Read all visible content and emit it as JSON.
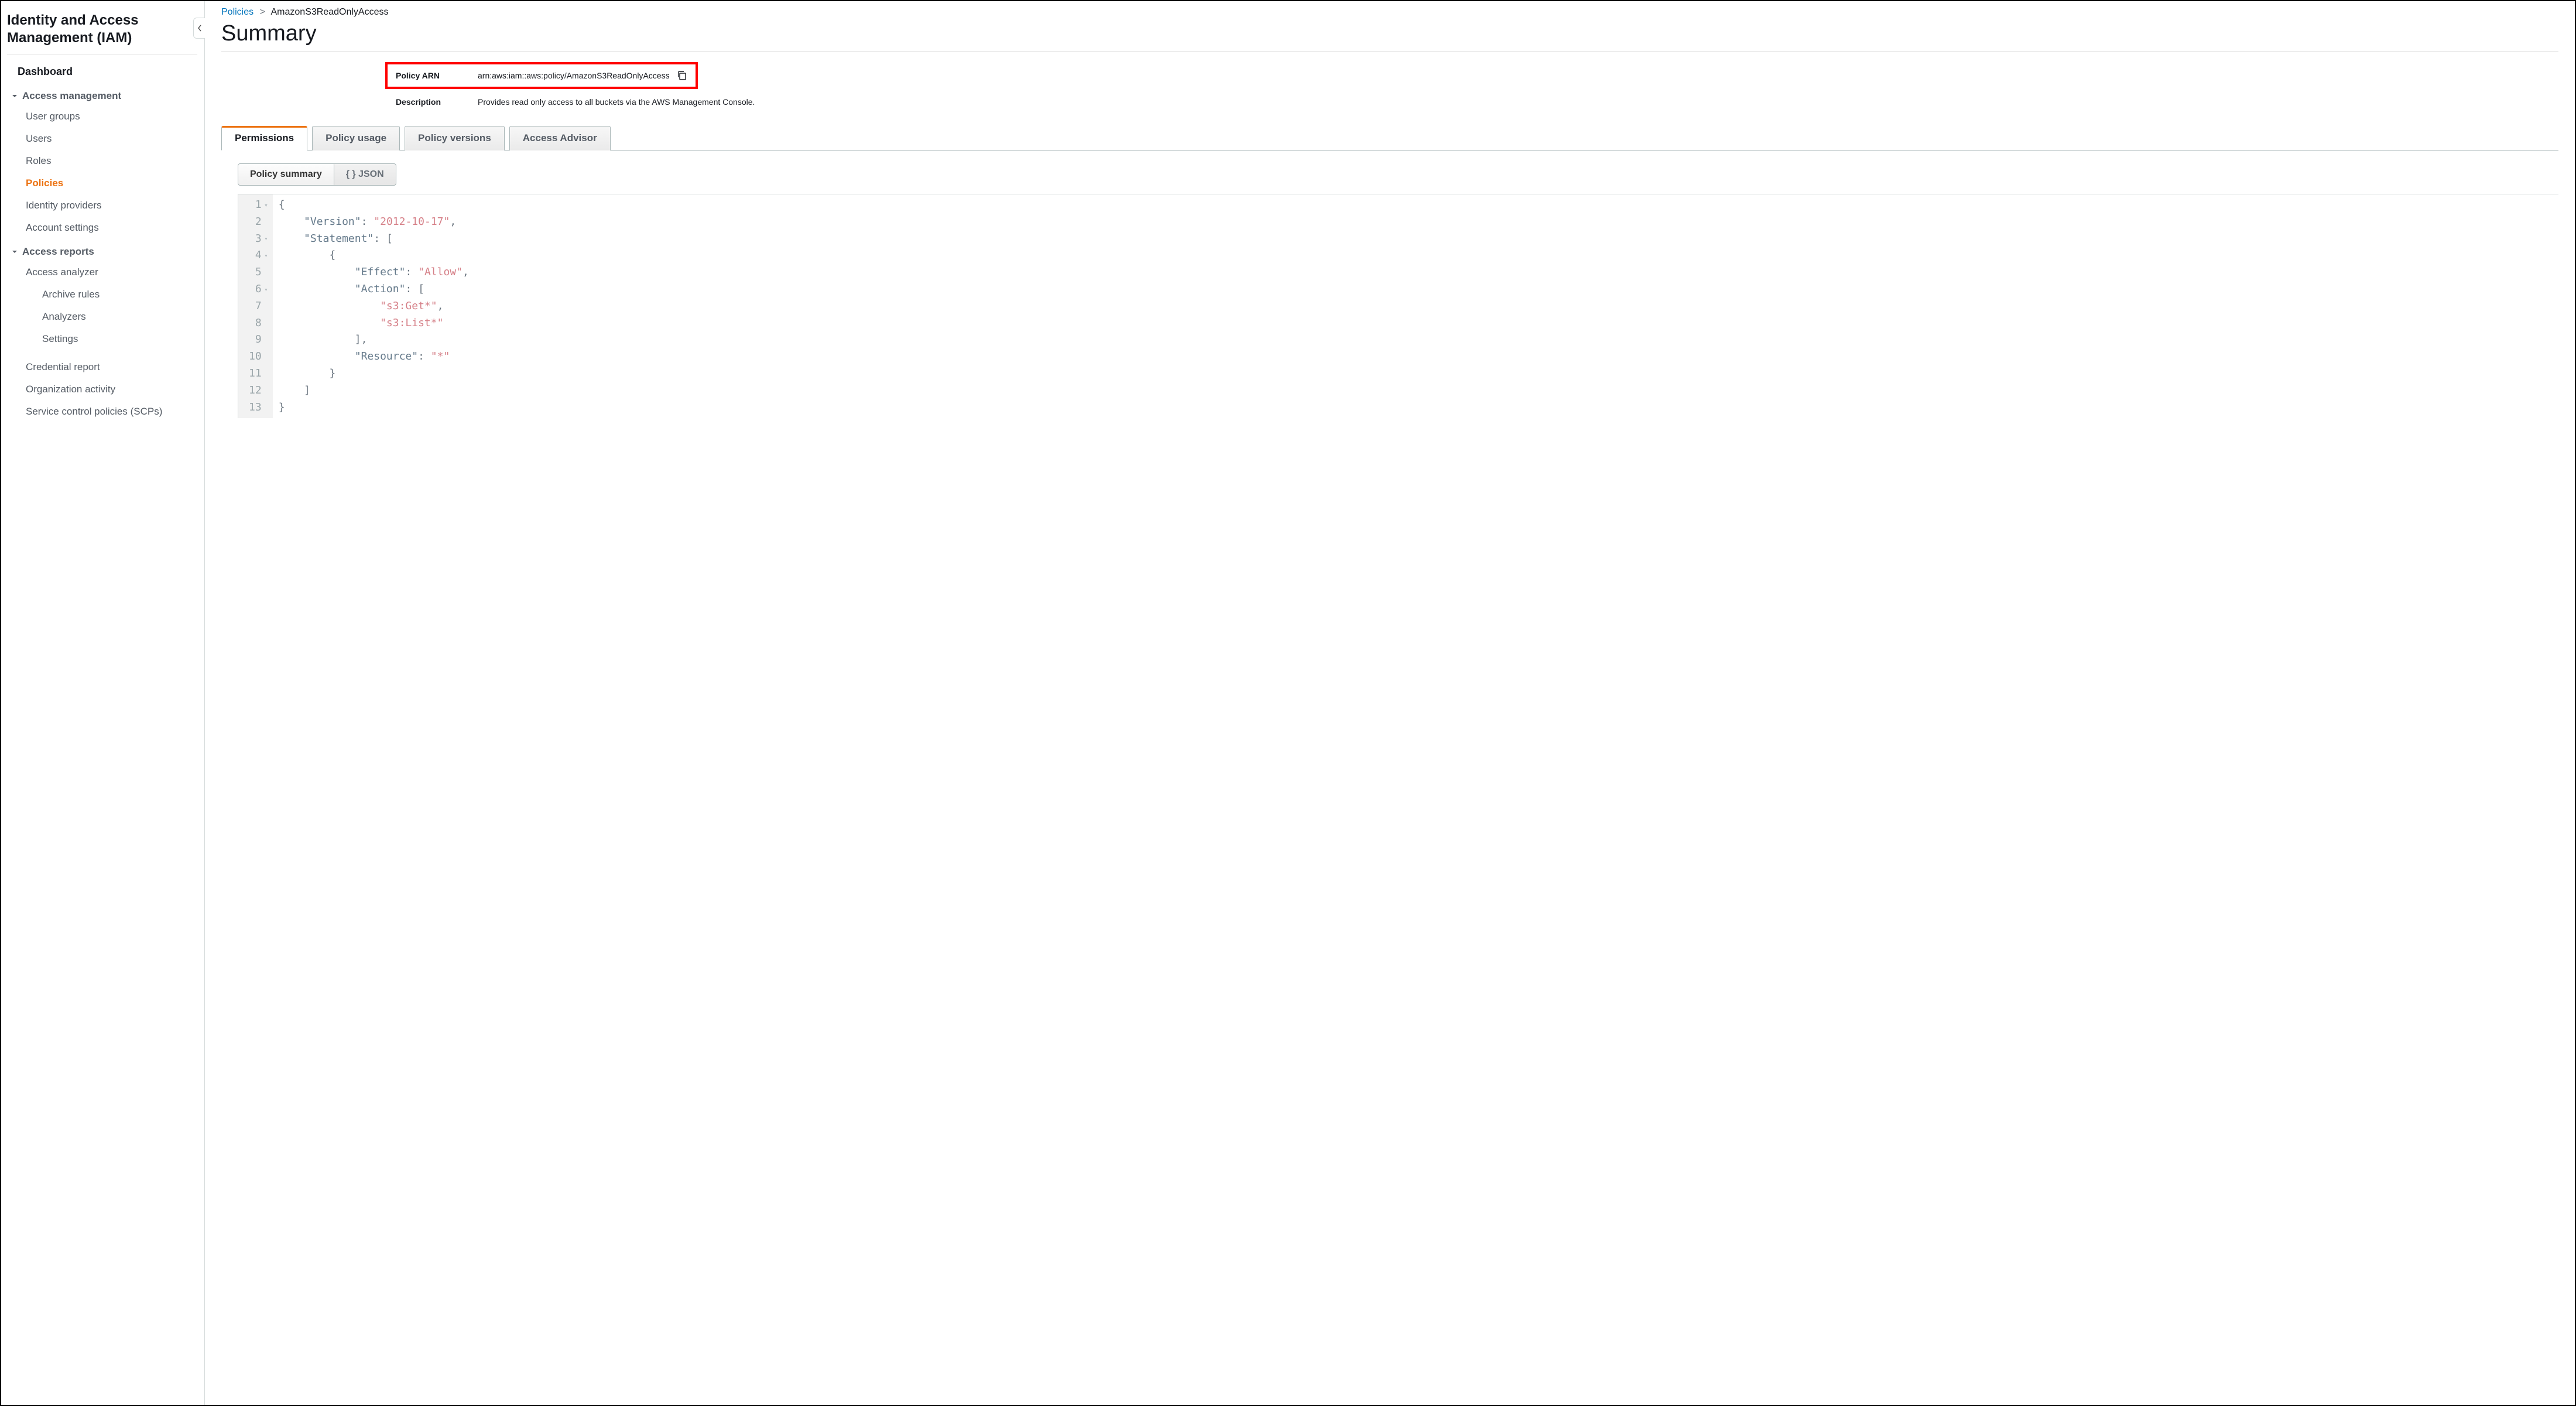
{
  "sidebar": {
    "title": "Identity and Access Management (IAM)",
    "dashboard": "Dashboard",
    "section_access_mgmt": "Access management",
    "items_access_mgmt": [
      "User groups",
      "Users",
      "Roles",
      "Policies",
      "Identity providers",
      "Account settings"
    ],
    "section_access_reports": "Access reports",
    "access_analyzer": "Access analyzer",
    "analyzer_children": [
      "Archive rules",
      "Analyzers",
      "Settings"
    ],
    "report_items": [
      "Credential report",
      "Organization activity",
      "Service control policies (SCPs)"
    ]
  },
  "breadcrumb": {
    "root": "Policies",
    "current": "AmazonS3ReadOnlyAccess"
  },
  "page_title": "Summary",
  "arn": {
    "label": "Policy ARN",
    "value": "arn:aws:iam::aws:policy/AmazonS3ReadOnlyAccess"
  },
  "description": {
    "label": "Description",
    "value": "Provides read only access to all buckets via the AWS Management Console."
  },
  "tabs": [
    "Permissions",
    "Policy usage",
    "Policy versions",
    "Access Advisor"
  ],
  "subtabs": {
    "summary": "Policy summary",
    "json": "{ } JSON"
  },
  "json_lines": {
    "l1": "{",
    "l2_k": "\"Version\"",
    "l2_v": "\"2012-10-17\"",
    "l3_k": "\"Statement\"",
    "l4": "{",
    "l5_k": "\"Effect\"",
    "l5_v": "\"Allow\"",
    "l6_k": "\"Action\"",
    "l7": "\"s3:Get*\"",
    "l8": "\"s3:List*\"",
    "l9": "],",
    "l10_k": "\"Resource\"",
    "l10_v": "\"*\"",
    "l11": "}",
    "l12": "]",
    "l13": "}"
  },
  "line_numbers": [
    "1",
    "2",
    "3",
    "4",
    "5",
    "6",
    "7",
    "8",
    "9",
    "10",
    "11",
    "12",
    "13"
  ]
}
